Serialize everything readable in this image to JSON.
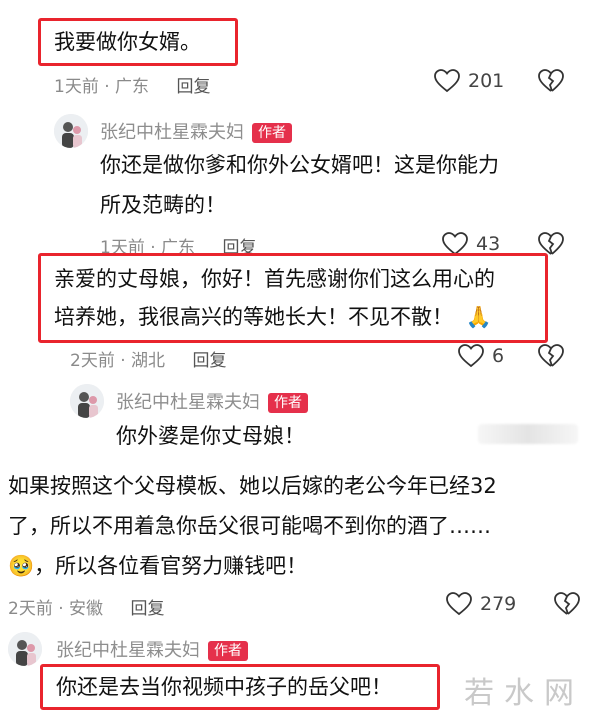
{
  "comment1": {
    "text": "我要做你女婿。",
    "time": "1天前",
    "location": "广东",
    "reply": "回复",
    "likes": "201"
  },
  "reply1": {
    "username": "张纪中杜星霖夫妇",
    "badge": "作者",
    "line1": "你还是做你爹和你外公女婿吧！这是你能力",
    "line2": "所及范畴的！",
    "time": "1天前",
    "location": "广东",
    "reply": "回复",
    "likes": "43"
  },
  "comment2": {
    "line1": "亲爱的丈母娘，你好！首先感谢你们这么用心的",
    "line2": "培养她，我很高兴的等她长大！不见不散！",
    "emoji": "🙏",
    "time": "2天前",
    "location": "湖北",
    "reply": "回复",
    "likes": "6"
  },
  "reply2": {
    "username": "张纪中杜星霖夫妇",
    "badge": "作者",
    "text": "你外婆是你丈母娘！"
  },
  "comment3": {
    "line1": "如果按照这个父母模板、她以后嫁的老公今年已经32",
    "line2": "了，所以不用着急你岳父很可能喝不到你的酒了……",
    "emoji": "🥹",
    "line3": "，所以各位看官努力赚钱吧！",
    "time": "2天前",
    "location": "安徽",
    "reply": "回复",
    "likes": "279"
  },
  "reply3": {
    "username": "张纪中杜星霖夫妇",
    "badge": "作者",
    "text": "你还是去当你视频中孩子的岳父吧！"
  },
  "watermark": "若水网",
  "colors": {
    "highlight": "#e9242d",
    "badge": "#e5304b",
    "meta": "#8a8a8a"
  },
  "icons": {
    "like": "heart-outline-icon",
    "dislike": "broken-heart-icon"
  }
}
